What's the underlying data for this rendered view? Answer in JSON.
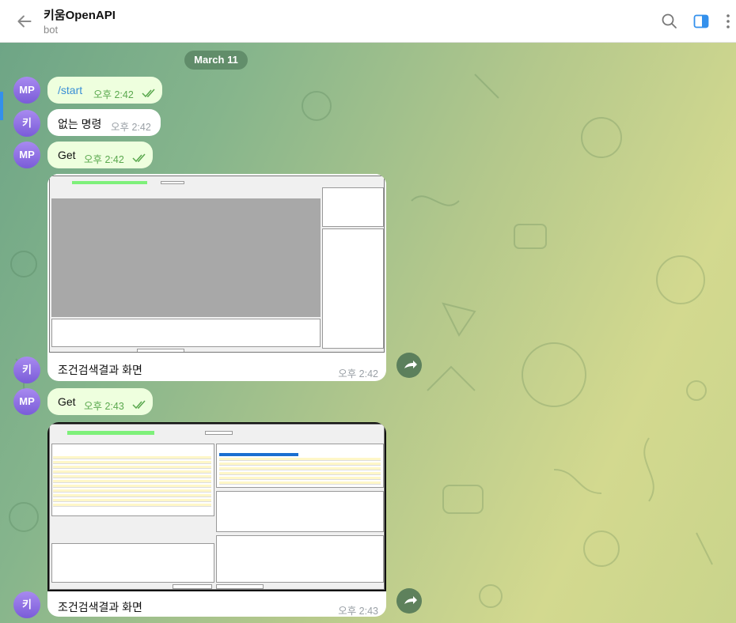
{
  "header": {
    "title": "키움OpenAPI",
    "subtitle": "bot"
  },
  "chat": {
    "date": "March 11",
    "messages": [
      {
        "avatar": "MP",
        "text": "/start",
        "time": "오후 2:42",
        "dir": "out"
      },
      {
        "avatar": "키",
        "text": "없는 명령",
        "time": "오후 2:42",
        "dir": "in"
      },
      {
        "avatar": "MP",
        "text": "Get",
        "time": "오후 2:42",
        "dir": "out"
      },
      {
        "avatar": "키",
        "caption": "조건검색결과 화면",
        "time": "오후 2:42",
        "dir": "in"
      },
      {
        "avatar": "MP",
        "text": "Get",
        "time": "오후 2:43",
        "dir": "out"
      },
      {
        "avatar": "키",
        "caption": "조건검색결과 화면",
        "time": "오후 2:43",
        "dir": "in"
      }
    ]
  },
  "colors": {
    "accent": "#3390ec",
    "out_bubble": "#eeffde",
    "out_time": "#5aa84e",
    "avatar_gradient": "#8e6fe6"
  },
  "icons": {
    "back": "arrow-left-icon",
    "search": "search-icon",
    "sidebar": "sidebar-toggle-icon",
    "more": "more-vertical-icon",
    "read": "double-check-icon",
    "forward": "forward-arrow-icon"
  }
}
